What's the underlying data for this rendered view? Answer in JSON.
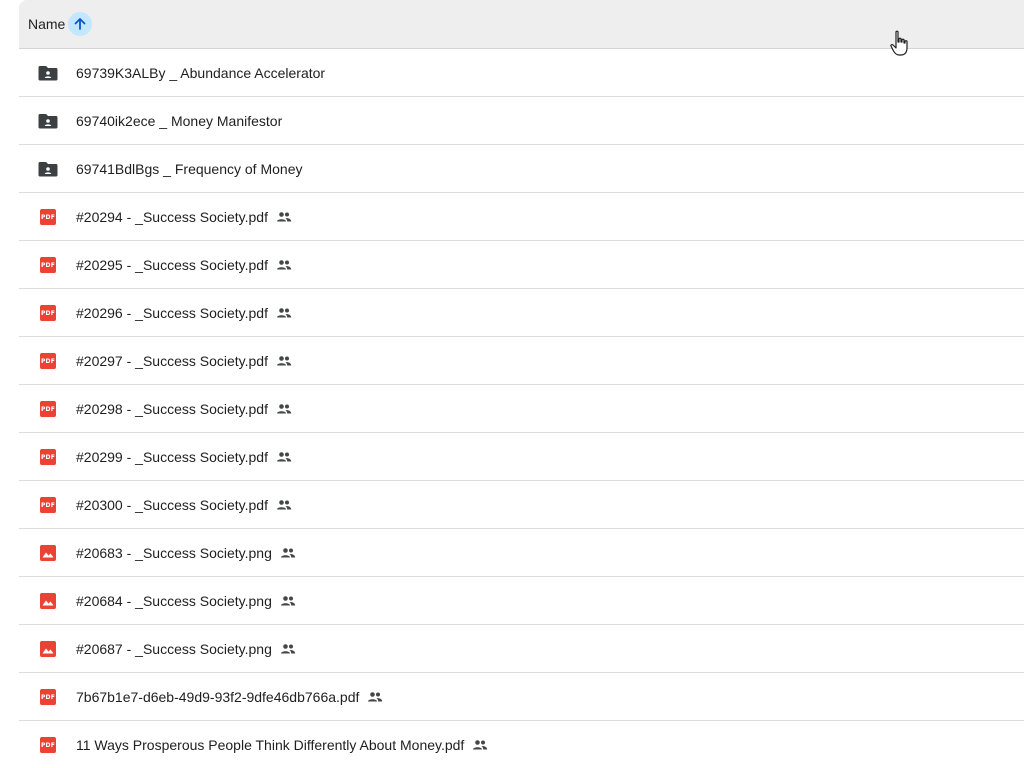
{
  "header": {
    "name_label": "Name",
    "sort_icon": "arrow-up-icon"
  },
  "colors": {
    "folder": "#3c4043",
    "file_red": "#ea4335",
    "sort_highlight": "#c2e7ff",
    "row_divider": "#dadce0"
  },
  "rows": [
    {
      "name": "69739K3ALBy _ Abundance Accelerator",
      "type": "folder",
      "shared": false
    },
    {
      "name": "69740ik2ece _ Money Manifestor",
      "type": "folder",
      "shared": false
    },
    {
      "name": "69741BdlBgs _ Frequency of Money",
      "type": "folder",
      "shared": false
    },
    {
      "name": "#20294 - _Success Society.pdf",
      "type": "pdf",
      "shared": true
    },
    {
      "name": "#20295 - _Success Society.pdf",
      "type": "pdf",
      "shared": true
    },
    {
      "name": "#20296 - _Success Society.pdf",
      "type": "pdf",
      "shared": true
    },
    {
      "name": "#20297 - _Success Society.pdf",
      "type": "pdf",
      "shared": true
    },
    {
      "name": "#20298 - _Success Society.pdf",
      "type": "pdf",
      "shared": true
    },
    {
      "name": "#20299 - _Success Society.pdf",
      "type": "pdf",
      "shared": true
    },
    {
      "name": "#20300 - _Success Society.pdf",
      "type": "pdf",
      "shared": true
    },
    {
      "name": "#20683 - _Success Society.png",
      "type": "image",
      "shared": true
    },
    {
      "name": "#20684 - _Success Society.png",
      "type": "image",
      "shared": true
    },
    {
      "name": "#20687 - _Success Society.png",
      "type": "image",
      "shared": true
    },
    {
      "name": "7b67b1e7-d6eb-49d9-93f2-9dfe46db766a.pdf",
      "type": "pdf",
      "shared": true
    },
    {
      "name": "11 Ways Prosperous People Think Differently About Money.pdf",
      "type": "pdf",
      "shared": true
    }
  ],
  "icons": {
    "pdf_badge_text": "PDF",
    "folder": "shared-folder-icon",
    "image": "image-file-icon",
    "shared": "people-icon"
  }
}
